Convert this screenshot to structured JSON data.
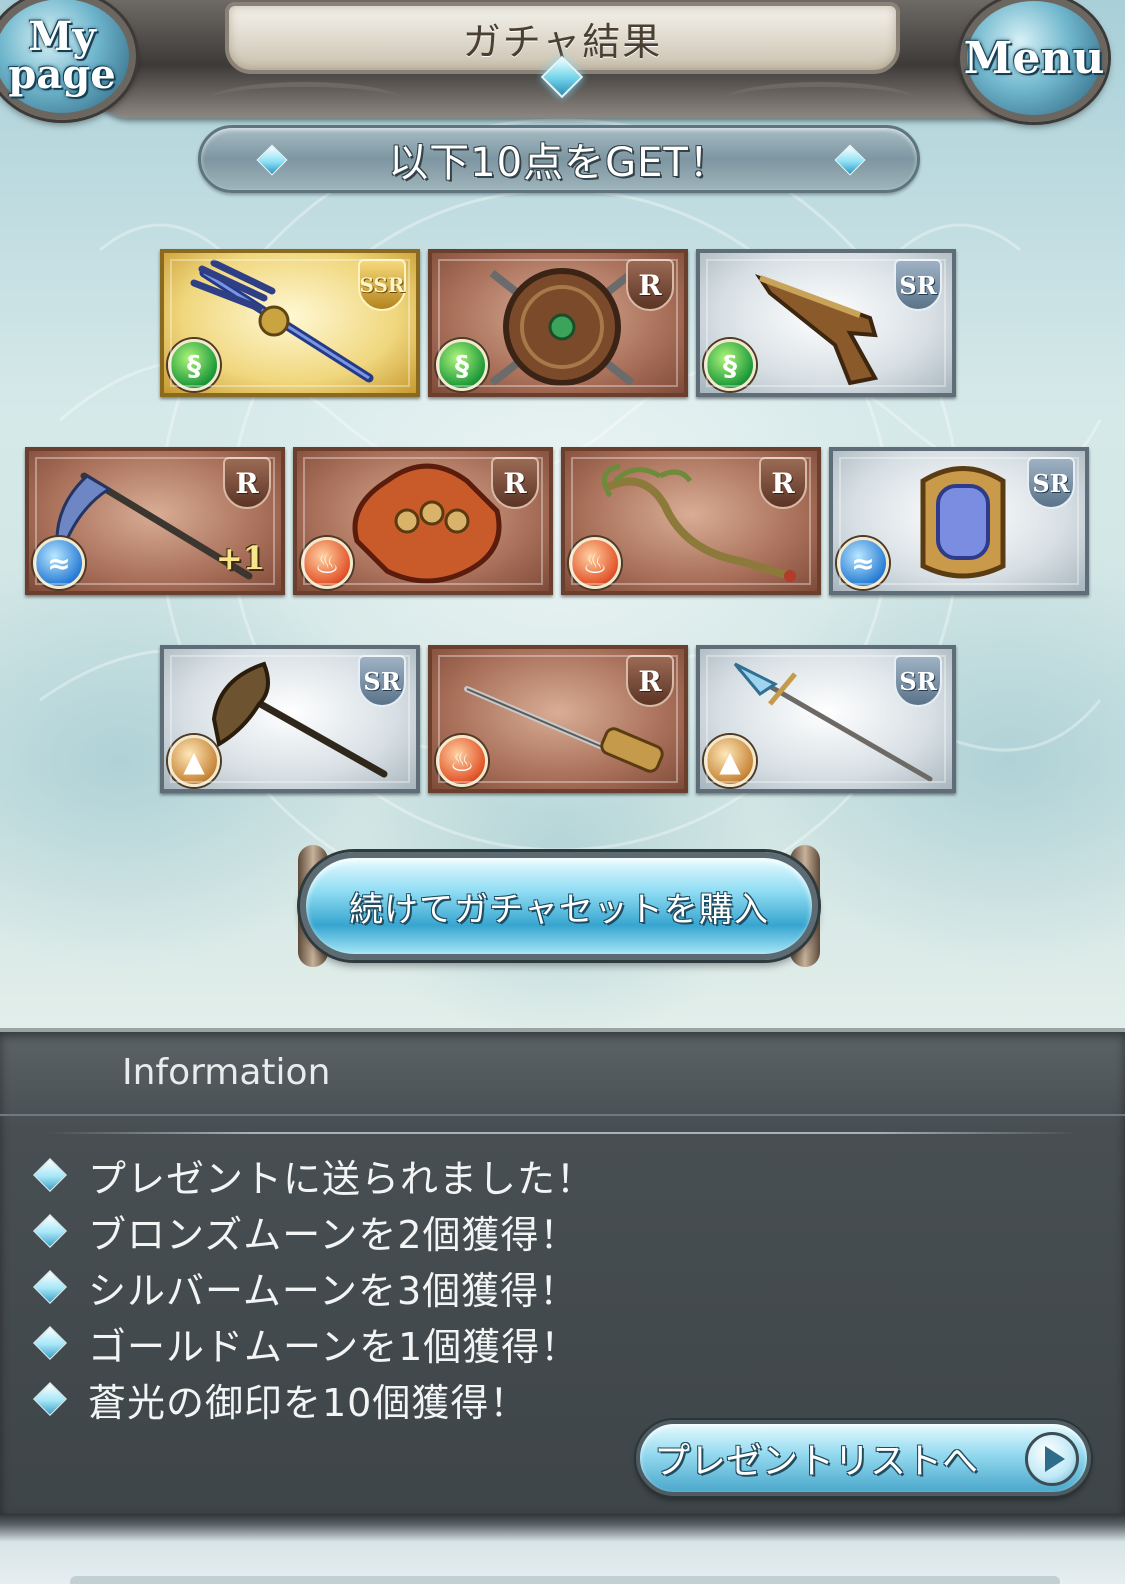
{
  "header": {
    "title": "ガチャ結果",
    "mypage_label_1": "My",
    "mypage_label_2": "page",
    "menu_label": "Menu"
  },
  "banner": {
    "text": "以下10点をGET！"
  },
  "items": [
    {
      "rarity": "SSR",
      "element": "wind",
      "weapon": "trident-icon",
      "plus": ""
    },
    {
      "rarity": "R",
      "element": "wind",
      "weapon": "shield-icon",
      "plus": ""
    },
    {
      "rarity": "SR",
      "element": "wind",
      "weapon": "pistol-icon",
      "plus": ""
    },
    {
      "rarity": "R",
      "element": "water",
      "weapon": "scythe-icon",
      "plus": "+1"
    },
    {
      "rarity": "R",
      "element": "fire",
      "weapon": "knuckle-icon",
      "plus": ""
    },
    {
      "rarity": "R",
      "element": "fire",
      "weapon": "staff-icon",
      "plus": ""
    },
    {
      "rarity": "SR",
      "element": "water",
      "weapon": "harp-icon",
      "plus": ""
    },
    {
      "rarity": "SR",
      "element": "earth",
      "weapon": "axe-icon",
      "plus": ""
    },
    {
      "rarity": "R",
      "element": "fire",
      "weapon": "sword-icon",
      "plus": ""
    },
    {
      "rarity": "SR",
      "element": "earth",
      "weapon": "spear-icon",
      "plus": ""
    }
  ],
  "continue_button": {
    "label": "続けてガチャセットを購入"
  },
  "info": {
    "title": "Information",
    "messages": [
      "プレゼントに送られました！",
      "ブロンズムーンを2個獲得！",
      "シルバームーンを3個獲得！",
      "ゴールドムーンを1個獲得！",
      "蒼光の御印を10個獲得！"
    ],
    "present_button": "プレゼントリストへ"
  },
  "colors": {
    "rarity_r": "#a9705a",
    "rarity_sr": "#d7dfe4",
    "rarity_ssr": "#f0d77e",
    "accent_blue": "#37a5cf",
    "panel_dark": "#484f53"
  }
}
